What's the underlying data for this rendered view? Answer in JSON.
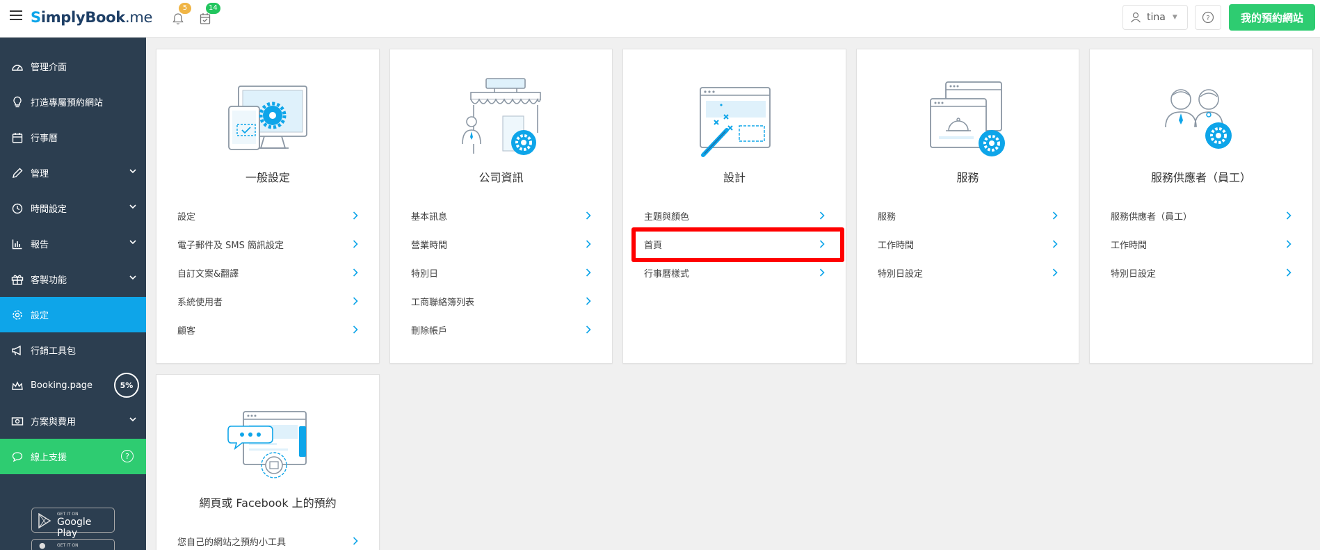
{
  "header": {
    "logo_s": "S",
    "logo_rest": "implyBook",
    "logo_me": ".me",
    "notif_count": "5",
    "calendar_count": "14",
    "user_name": "tina",
    "help_label": "?",
    "site_button": "我的預約網站"
  },
  "sidebar": {
    "items": [
      {
        "label": "管理介面",
        "icon": "dashboard-icon"
      },
      {
        "label": "打造專屬預約網站",
        "icon": "lightbulb-icon"
      },
      {
        "label": "行事曆",
        "icon": "calendar-icon"
      },
      {
        "label": "管理",
        "icon": "pencil-icon"
      },
      {
        "label": "時間設定",
        "icon": "clock-icon"
      },
      {
        "label": "報告",
        "icon": "bar-chart-icon"
      },
      {
        "label": "客製功能",
        "icon": "gift-icon"
      },
      {
        "label": "設定",
        "icon": "gear-icon"
      },
      {
        "label": "行銷工具包",
        "icon": "megaphone-icon"
      },
      {
        "label": "Booking.page",
        "icon": "crown-icon"
      },
      {
        "label": "方案與費用",
        "icon": "money-icon"
      },
      {
        "label": "線上支援",
        "icon": "chat-icon"
      }
    ],
    "booking_progress": "5%",
    "support_help": "?",
    "store_google_small": "GET IT ON",
    "store_google_big": "Google Play",
    "store_apple_small": "GET IT ON"
  },
  "cards": [
    {
      "title": "一般設定",
      "links": [
        "設定",
        "電子郵件及 SMS 簡訊設定",
        "自訂文案&翻譯",
        "系統使用者",
        "顧客"
      ]
    },
    {
      "title": "公司資訊",
      "links": [
        "基本訊息",
        "營業時間",
        "特別日",
        "工商聯絡簿列表",
        "刪除帳戶"
      ]
    },
    {
      "title": "設計",
      "links": [
        "主題與顏色",
        "首頁",
        "行事曆樣式"
      ]
    },
    {
      "title": "服務",
      "links": [
        "服務",
        "工作時間",
        "特別日設定"
      ]
    },
    {
      "title": "服務供應者（員工）",
      "links": [
        "服務供應者（員工）",
        "工作時間",
        "特別日設定"
      ]
    },
    {
      "title": "網頁或 Facebook 上的預約",
      "links": [
        "您自己的網站之預約小工具"
      ]
    }
  ],
  "colors": {
    "accent": "#0ea5e9",
    "sidebar_bg": "#2c3e50",
    "green": "#2ecc71",
    "highlight": "#ff0000"
  }
}
